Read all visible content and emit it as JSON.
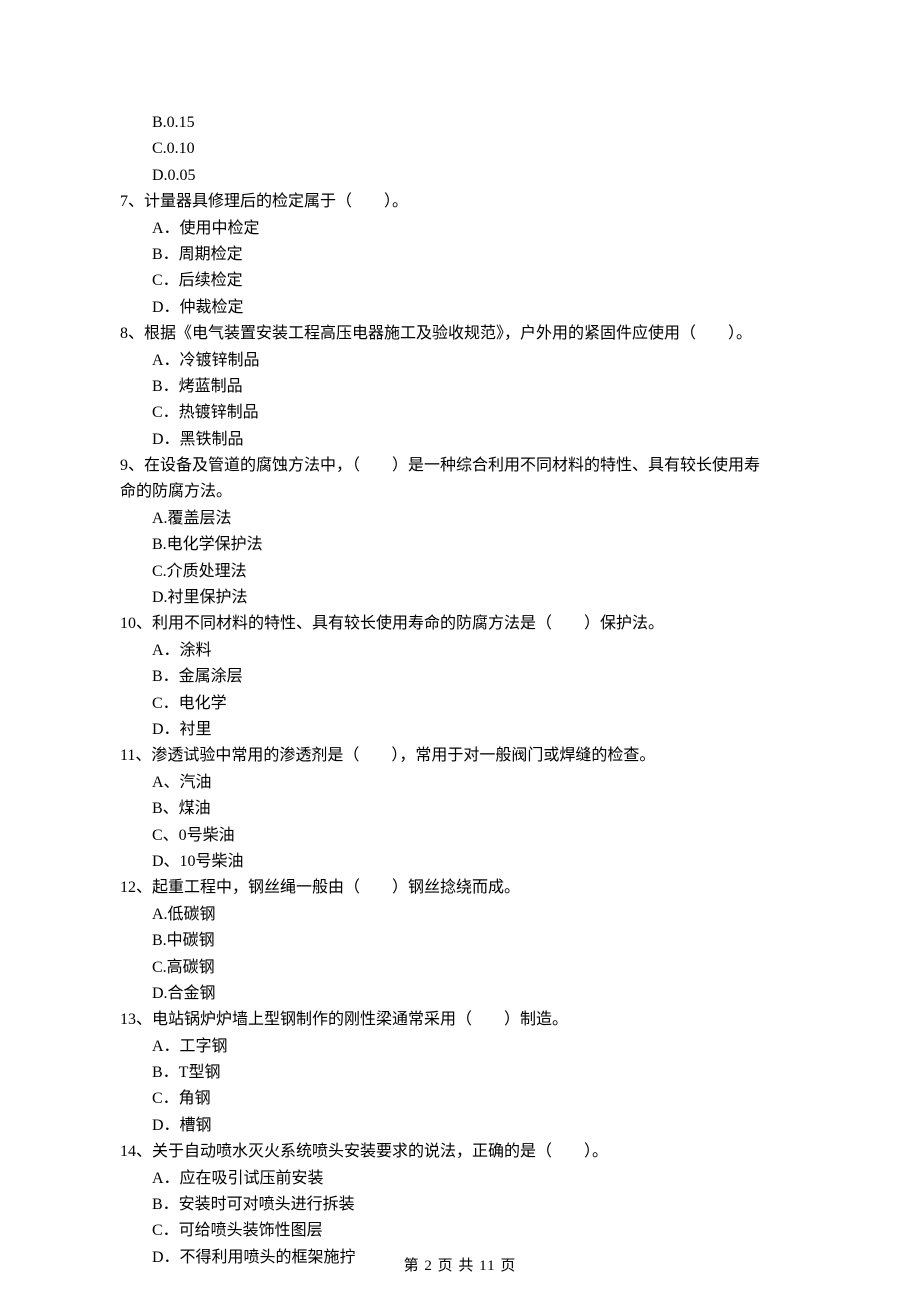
{
  "preOptions": {
    "b": "B.0.15",
    "c": "C.0.10",
    "d": "D.0.05"
  },
  "q7": {
    "stem": "7、计量器具修理后的检定属于（　　）。",
    "a": "A．使用中检定",
    "b": "B．周期检定",
    "c": "C．后续检定",
    "d": "D．仲裁检定"
  },
  "q8": {
    "stem": "8、根据《电气装置安装工程高压电器施工及验收规范》，户外用的紧固件应使用（　　）。",
    "a": "A．冷镀锌制品",
    "b": "B．烤蓝制品",
    "c": "C．热镀锌制品",
    "d": "D．黑铁制品"
  },
  "q9": {
    "stem1": "9、在设备及管道的腐蚀方法中，（　　）是一种综合利用不同材料的特性、具有较长使用寿",
    "stem2": "命的防腐方法。",
    "a": "A.覆盖层法",
    "b": "B.电化学保护法",
    "c": "C.介质处理法",
    "d": "D.衬里保护法"
  },
  "q10": {
    "stem": "10、利用不同材料的特性、具有较长使用寿命的防腐方法是（　　）保护法。",
    "a": "A．涂料",
    "b": "B．金属涂层",
    "c": "C．电化学",
    "d": "D．衬里"
  },
  "q11": {
    "stem": "11、渗透试验中常用的渗透剂是（　　），常用于对一般阀门或焊缝的检查。",
    "a": "A、汽油",
    "b": "B、煤油",
    "c": "C、0号柴油",
    "d": "D、10号柴油"
  },
  "q12": {
    "stem": "12、起重工程中，钢丝绳一般由（　　）钢丝捻绕而成。",
    "a": "A.低碳钢",
    "b": "B.中碳钢",
    "c": "C.高碳钢",
    "d": "D.合金钢"
  },
  "q13": {
    "stem": "13、电站锅炉炉墙上型钢制作的刚性梁通常采用（　　）制造。",
    "a": "A．工字钢",
    "b": "B．T型钢",
    "c": "C．角钢",
    "d": "D．槽钢"
  },
  "q14": {
    "stem": "14、关于自动喷水灭火系统喷头安装要求的说法，正确的是（　　）。",
    "a": "A．应在吸引试压前安装",
    "b": "B．安装时可对喷头进行拆装",
    "c": "C．可给喷头装饰性图层",
    "d": "D．不得利用喷头的框架施拧"
  },
  "footer": "第 2 页 共 11 页"
}
